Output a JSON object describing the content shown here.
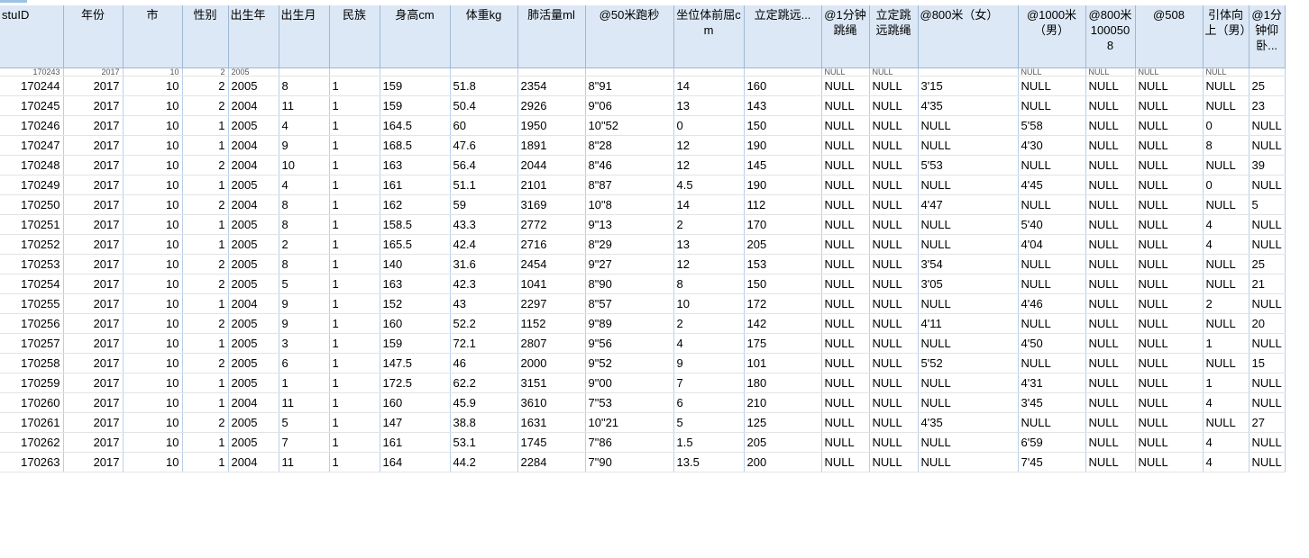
{
  "columns": [
    "stuID",
    "年份",
    "市",
    "性别",
    "出生年",
    "出生月",
    "民族",
    "身高cm",
    "体重kg",
    "肺活量ml",
    "@50米跑秒",
    "坐位体前屈cm",
    "立定跳远...",
    "@1分钟跳绳",
    "立定跳远跳绳",
    "@800米（女）",
    "@1000米（男）",
    "@800米1000508",
    "@508",
    "引体向上（男）",
    "@1分钟仰卧..."
  ],
  "partial_row": [
    "170243",
    "2017",
    "10",
    "2",
    "2005",
    "",
    "",
    "",
    "",
    "",
    "",
    "",
    "",
    "NULL",
    "NULL",
    "",
    "NULL",
    "NULL",
    "NULL",
    "NULL",
    ""
  ],
  "rows": [
    [
      "170244",
      "2017",
      "10",
      "2",
      "2005",
      "8",
      "1",
      "159",
      "51.8",
      "2354",
      "8\"91",
      "14",
      "160",
      "NULL",
      "NULL",
      "3'15",
      "NULL",
      "NULL",
      "NULL",
      "NULL",
      "25"
    ],
    [
      "170245",
      "2017",
      "10",
      "2",
      "2004",
      "11",
      "1",
      "159",
      "50.4",
      "2926",
      "9\"06",
      "13",
      "143",
      "NULL",
      "NULL",
      "4'35",
      "NULL",
      "NULL",
      "NULL",
      "NULL",
      "23"
    ],
    [
      "170246",
      "2017",
      "10",
      "1",
      "2005",
      "4",
      "1",
      "164.5",
      "60",
      "1950",
      "10\"52",
      "0",
      "150",
      "NULL",
      "NULL",
      "NULL",
      "5'58",
      "NULL",
      "NULL",
      "0",
      "NULL"
    ],
    [
      "170247",
      "2017",
      "10",
      "1",
      "2004",
      "9",
      "1",
      "168.5",
      "47.6",
      "1891",
      "8\"28",
      "12",
      "190",
      "NULL",
      "NULL",
      "NULL",
      "4'30",
      "NULL",
      "NULL",
      "8",
      "NULL"
    ],
    [
      "170248",
      "2017",
      "10",
      "2",
      "2004",
      "10",
      "1",
      "163",
      "56.4",
      "2044",
      "8\"46",
      "12",
      "145",
      "NULL",
      "NULL",
      "5'53",
      "NULL",
      "NULL",
      "NULL",
      "NULL",
      "39"
    ],
    [
      "170249",
      "2017",
      "10",
      "1",
      "2005",
      "4",
      "1",
      "161",
      "51.1",
      "2101",
      "8\"87",
      "4.5",
      "190",
      "NULL",
      "NULL",
      "NULL",
      "4'45",
      "NULL",
      "NULL",
      "0",
      "NULL"
    ],
    [
      "170250",
      "2017",
      "10",
      "2",
      "2004",
      "8",
      "1",
      "162",
      "59",
      "3169",
      "10\"8",
      "14",
      "112",
      "NULL",
      "NULL",
      "4'47",
      "NULL",
      "NULL",
      "NULL",
      "NULL",
      "5"
    ],
    [
      "170251",
      "2017",
      "10",
      "1",
      "2005",
      "8",
      "1",
      "158.5",
      "43.3",
      "2772",
      "9\"13",
      "2",
      "170",
      "NULL",
      "NULL",
      "NULL",
      "5'40",
      "NULL",
      "NULL",
      "4",
      "NULL"
    ],
    [
      "170252",
      "2017",
      "10",
      "1",
      "2005",
      "2",
      "1",
      "165.5",
      "42.4",
      "2716",
      "8\"29",
      "13",
      "205",
      "NULL",
      "NULL",
      "NULL",
      "4'04",
      "NULL",
      "NULL",
      "4",
      "NULL"
    ],
    [
      "170253",
      "2017",
      "10",
      "2",
      "2005",
      "8",
      "1",
      "140",
      "31.6",
      "2454",
      "9\"27",
      "12",
      "153",
      "NULL",
      "NULL",
      "3'54",
      "NULL",
      "NULL",
      "NULL",
      "NULL",
      "25"
    ],
    [
      "170254",
      "2017",
      "10",
      "2",
      "2005",
      "5",
      "1",
      "163",
      "42.3",
      "1041",
      "8\"90",
      "8",
      "150",
      "NULL",
      "NULL",
      "3'05",
      "NULL",
      "NULL",
      "NULL",
      "NULL",
      "21"
    ],
    [
      "170255",
      "2017",
      "10",
      "1",
      "2004",
      "9",
      "1",
      "152",
      "43",
      "2297",
      "8\"57",
      "10",
      "172",
      "NULL",
      "NULL",
      "NULL",
      "4'46",
      "NULL",
      "NULL",
      "2",
      "NULL"
    ],
    [
      "170256",
      "2017",
      "10",
      "2",
      "2005",
      "9",
      "1",
      "160",
      "52.2",
      "1152",
      "9\"89",
      "2",
      "142",
      "NULL",
      "NULL",
      "4'11",
      "NULL",
      "NULL",
      "NULL",
      "NULL",
      "20"
    ],
    [
      "170257",
      "2017",
      "10",
      "1",
      "2005",
      "3",
      "1",
      "159",
      "72.1",
      "2807",
      "9\"56",
      "4",
      "175",
      "NULL",
      "NULL",
      "NULL",
      "4'50",
      "NULL",
      "NULL",
      "1",
      "NULL"
    ],
    [
      "170258",
      "2017",
      "10",
      "2",
      "2005",
      "6",
      "1",
      "147.5",
      "46",
      "2000",
      "9\"52",
      "9",
      "101",
      "NULL",
      "NULL",
      "5'52",
      "NULL",
      "NULL",
      "NULL",
      "NULL",
      "15"
    ],
    [
      "170259",
      "2017",
      "10",
      "1",
      "2005",
      "1",
      "1",
      "172.5",
      "62.2",
      "3151",
      "9\"00",
      "7",
      "180",
      "NULL",
      "NULL",
      "NULL",
      "4'31",
      "NULL",
      "NULL",
      "1",
      "NULL"
    ],
    [
      "170260",
      "2017",
      "10",
      "1",
      "2004",
      "11",
      "1",
      "160",
      "45.9",
      "3610",
      "7\"53",
      "6",
      "210",
      "NULL",
      "NULL",
      "NULL",
      "3'45",
      "NULL",
      "NULL",
      "4",
      "NULL"
    ],
    [
      "170261",
      "2017",
      "10",
      "2",
      "2005",
      "5",
      "1",
      "147",
      "38.8",
      "1631",
      "10\"21",
      "5",
      "125",
      "NULL",
      "NULL",
      "4'35",
      "NULL",
      "NULL",
      "NULL",
      "NULL",
      "27"
    ],
    [
      "170262",
      "2017",
      "10",
      "1",
      "2005",
      "7",
      "1",
      "161",
      "53.1",
      "1745",
      "7\"86",
      "1.5",
      "205",
      "NULL",
      "NULL",
      "NULL",
      "6'59",
      "NULL",
      "NULL",
      "4",
      "NULL"
    ],
    [
      "170263",
      "2017",
      "10",
      "1",
      "2004",
      "11",
      "1",
      "164",
      "44.2",
      "2284",
      "7\"90",
      "13.5",
      "200",
      "NULL",
      "NULL",
      "NULL",
      "7'45",
      "NULL",
      "NULL",
      "4",
      "NULL"
    ]
  ]
}
